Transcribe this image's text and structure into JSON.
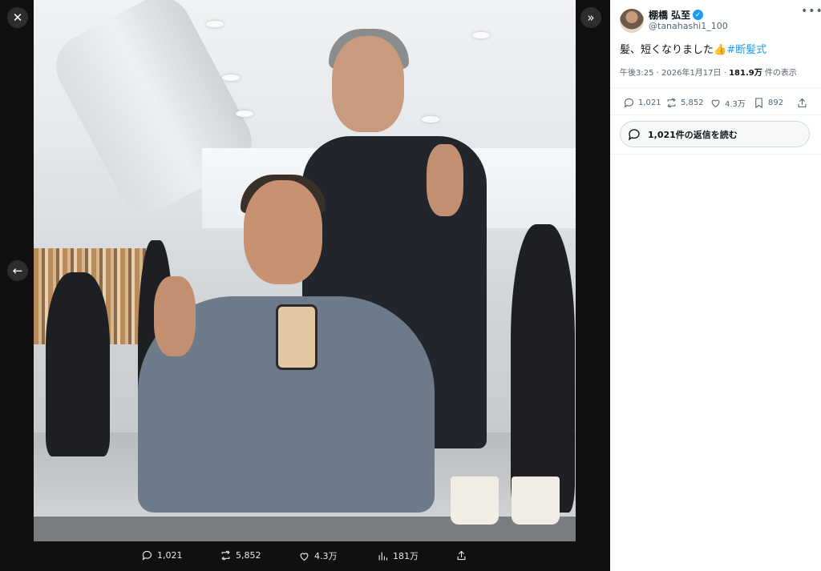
{
  "viewer": {
    "close_icon": "close-icon",
    "collapse_icon": "double-chevron-right-icon",
    "prev_icon": "arrow-left-icon",
    "photo_alt": "",
    "stats": {
      "replies": "1,021",
      "retweets": "5,852",
      "likes": "4.3万",
      "views": "181万"
    }
  },
  "tweet": {
    "display_name": "棚橋 弘至",
    "handle": "@tanahashi1_100",
    "text": "髪、短くなりました👍",
    "hashtag": "#断髪式",
    "time": "午後3:25 · 2026年1月17日 · ",
    "views_count": "181.9万",
    "views_suffix": " 件の表示",
    "actions": {
      "replies": "1,021",
      "retweets": "5,852",
      "likes": "4.3万",
      "bookmarks": "892"
    },
    "read_replies_label": "1,021件の返信を読む"
  },
  "colors": {
    "accent": "#1d9bf0",
    "verified": "#1d9bf0",
    "viewer_bg": "#101010"
  }
}
